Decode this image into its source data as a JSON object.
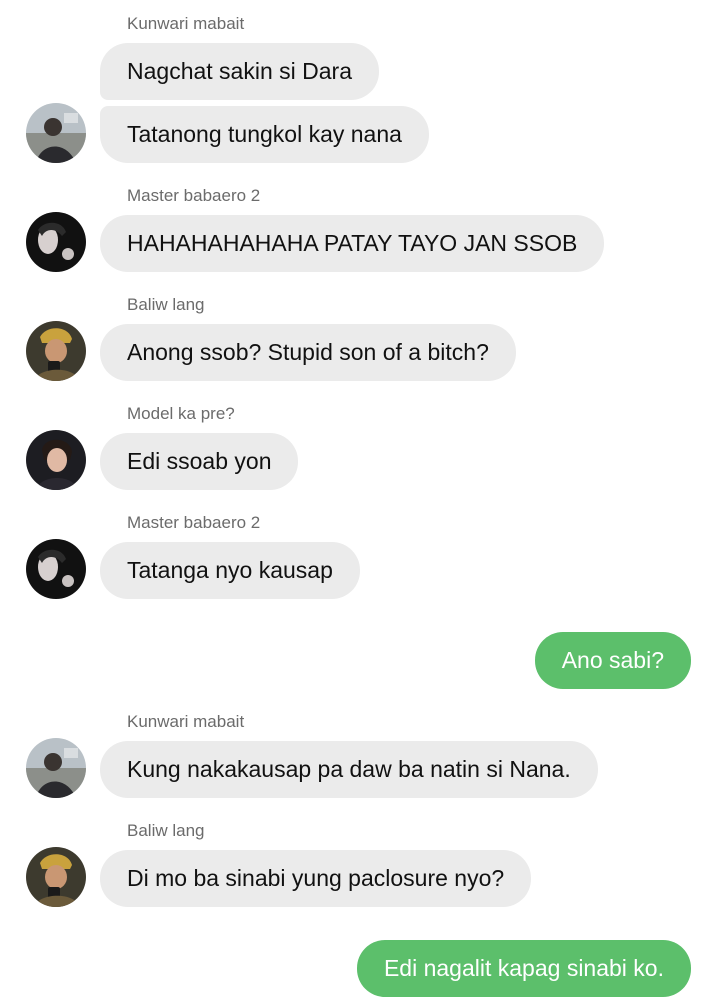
{
  "messages": [
    {
      "sender": "Kunwari mabait",
      "text": "Nagchat sakin si Dara"
    },
    {
      "text": "Tatanong tungkol kay nana"
    },
    {
      "sender": "Master babaero 2",
      "text": "HAHAHAHAHAHA PATAY TAYO JAN SSOB"
    },
    {
      "sender": "Baliw lang",
      "text": "Anong ssob? Stupid son of a bitch?"
    },
    {
      "sender": "Model ka pre?",
      "text": "Edi ssoab yon"
    },
    {
      "sender": "Master babaero 2",
      "text": "Tatanga nyo kausap"
    },
    {
      "text": "Ano sabi?"
    },
    {
      "sender": "Kunwari mabait",
      "text": "Kung nakakausap pa daw ba natin si Nana."
    },
    {
      "sender": "Baliw lang",
      "text": "Di mo ba sinabi yung paclosure nyo?"
    },
    {
      "text": "Edi nagalit kapag sinabi ko."
    }
  ],
  "colors": {
    "incoming_bubble": "#ebebeb",
    "outgoing_bubble": "#5cbf6b",
    "sender_text": "#6b6b6b"
  },
  "avatars": [
    "kunwari-mabait-avatar",
    "master-babaero-2-avatar",
    "baliw-lang-avatar",
    "model-ka-pre-avatar"
  ]
}
